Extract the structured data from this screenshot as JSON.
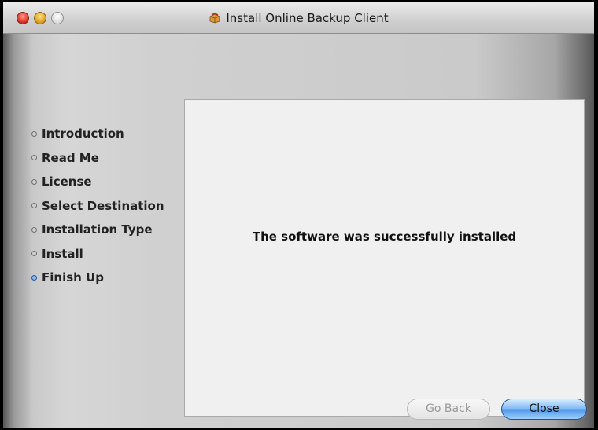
{
  "window": {
    "title": "Install Online Backup Client",
    "title_icon": "package-icon"
  },
  "steps": [
    {
      "label": "Introduction",
      "state": "done"
    },
    {
      "label": "Read Me",
      "state": "done"
    },
    {
      "label": "License",
      "state": "done"
    },
    {
      "label": "Select Destination",
      "state": "done"
    },
    {
      "label": "Installation Type",
      "state": "done"
    },
    {
      "label": "Install",
      "state": "done"
    },
    {
      "label": "Finish Up",
      "state": "current"
    }
  ],
  "main": {
    "message": "The software was successfully installed"
  },
  "buttons": {
    "back_label": "Go Back",
    "back_enabled": false,
    "close_label": "Close",
    "close_default": true
  },
  "colors": {
    "current_step_bullet": "#8fb8ef",
    "default_button": "#4e94e6"
  }
}
